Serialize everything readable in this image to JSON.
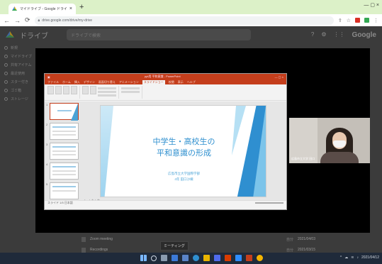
{
  "browser": {
    "tab_title": "マイドライブ - Google ドライブ",
    "tab_close": "×",
    "new_tab": "+",
    "url": "drive.google.com/drive/my-drive",
    "window_controls": "— ▢ ×"
  },
  "drive": {
    "app_name": "ドライブ",
    "search_placeholder": "ドライブで検索",
    "brand": "Google",
    "sidebar": [
      "新規",
      "マイドライブ",
      "共有アイテム",
      "最近使用",
      "スター付き",
      "ゴミ箱",
      "ストレージ"
    ],
    "files": [
      {
        "name": "Zoom meeting",
        "meta": "自分",
        "date": "2021/04/03"
      },
      {
        "name": "Recordings",
        "meta": "自分",
        "date": "2021/03/15"
      }
    ]
  },
  "powerpoint": {
    "window_title": "ppt用 平和意識 - PowerPoint",
    "tabs": [
      "ファイル",
      "ホーム",
      "挿入",
      "デザイン",
      "画面切り替え",
      "アニメーション",
      "スライドショー",
      "校閲",
      "表示",
      "ヘルプ"
    ],
    "active_tab": "スライドショー",
    "slide_count": 5,
    "slide_title_line1": "中学生・高校生の",
    "slide_title_line2": "平和意識の形成",
    "slide_sub_line1": "広島市立大学国際学部",
    "slide_sub_line2": "4年  田口沙織",
    "notes_label": "ノートを入力",
    "status_text": "スライド 1/5  日本語"
  },
  "participant": {
    "name": "広島市立大学 田口"
  },
  "taskbar": {
    "tooltip": "ミーティング",
    "clock": "2021/04/12"
  },
  "colors": {
    "accent_ppt": "#c43e1c",
    "slide_blue": "#2e8fcf",
    "chrome_tab_bg": "#dcf1c8"
  }
}
